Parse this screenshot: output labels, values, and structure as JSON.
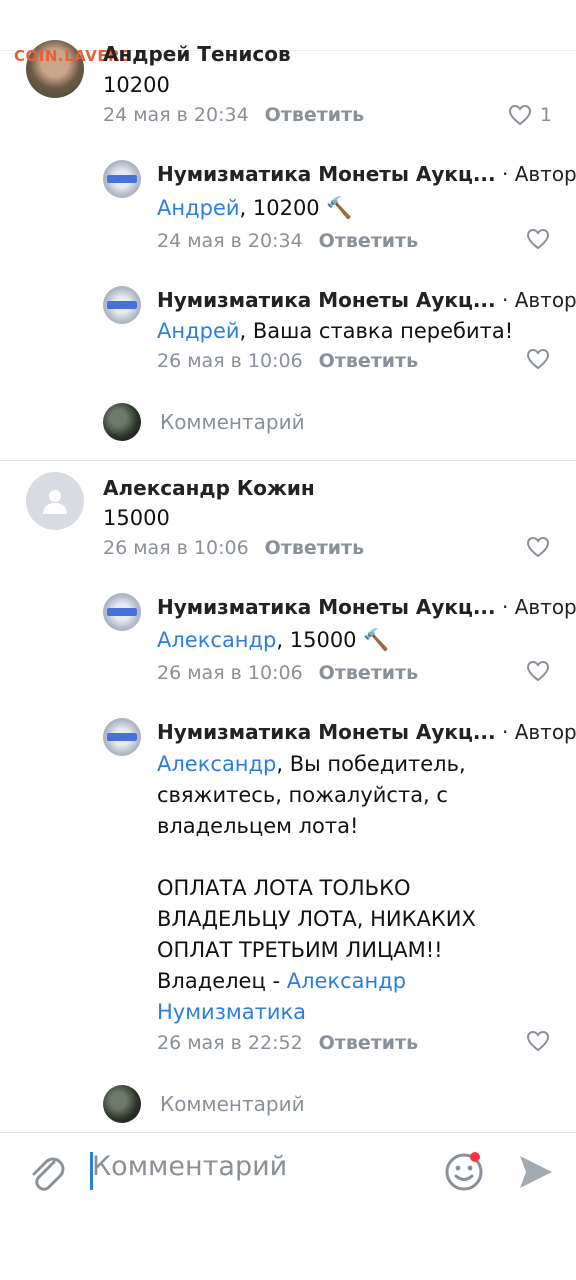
{
  "watermark": "COIN.LAVERS",
  "comments": [
    {
      "author": "Андрей Тенисов",
      "text": "10200",
      "date": "24 мая в 20:34",
      "reply": "Ответить",
      "likes": "1"
    },
    {
      "author": "Нумизматика Монеты Аукц...",
      "badge": "Автор",
      "mention": "Андрей",
      "text": ", 10200 🔨",
      "date": "24 мая в 20:34",
      "reply": "Ответить"
    },
    {
      "author": "Нумизматика Монеты Аукц...",
      "badge": "Автор",
      "mention": "Андрей",
      "text": ", Ваша ставка перебита!",
      "date": "26 мая в 10:06",
      "reply": "Ответить"
    },
    {
      "author": "Александр Кожин",
      "text": "15000",
      "date": "26 мая в 10:06",
      "reply": "Ответить"
    },
    {
      "author": "Нумизматика Монеты Аукц...",
      "badge": "Автор",
      "mention": "Александр",
      "text": ", 15000 🔨",
      "date": "26 мая в 10:06",
      "reply": "Ответить"
    },
    {
      "author": "Нумизматика Монеты Аукц...",
      "badge": "Автор",
      "mention": "Александр",
      "text_lines": [
        ", Вы победитель,",
        "свяжитесь, пожалуйста, с",
        "владельцем лота!",
        "",
        "ОПЛАТА ЛОТА ТОЛЬКО",
        "ВЛАДЕЛЬЦУ ЛОТА, НИКАКИХ",
        "ОПЛАТ ТРЕТЬИМ ЛИЦАМ!!",
        "Владелец - "
      ],
      "owner_link_1": "Александр",
      "owner_link_2": "Нумизматика",
      "date": "26 мая в 22:52",
      "reply": "Ответить"
    }
  ],
  "reply_placeholder": "Комментарий",
  "input": {
    "placeholder": "Комментарий"
  },
  "icons": {
    "attach": "paperclip-icon",
    "emoji": "smile-icon",
    "send": "send-icon",
    "like": "heart-icon"
  },
  "colors": {
    "link": "#2b7ee0",
    "secondary": "#8a9099",
    "notification_dot": "#ff3347"
  }
}
